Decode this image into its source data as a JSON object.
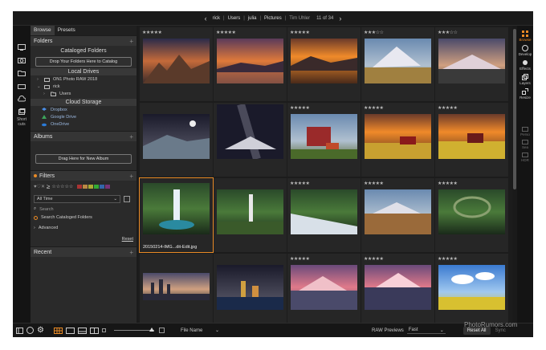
{
  "breadcrumb": [
    "rick",
    "Users",
    "julia",
    "Pictures",
    "Tim Uhler"
  ],
  "breadcrumb_seps": [
    "|",
    "|",
    "|",
    "|"
  ],
  "nav": {
    "prev": "‹",
    "next": "›",
    "count": "11 of 34"
  },
  "left_rail": {
    "shortcuts_label": "Short\ncuts"
  },
  "tabs": [
    "Browse",
    "Presets"
  ],
  "folders": {
    "title": "Folders",
    "cataloged_title": "Cataloged Folders",
    "drop_button": "Drop Your Folders Here to Catalog",
    "local_title": "Local Drives",
    "local_items": [
      "ON1 Photo RAW 2018",
      "rick",
      "Users"
    ],
    "cloud_title": "Cloud Storage",
    "cloud_items": [
      "Dropbox",
      "Google Drive",
      "OneDrive"
    ]
  },
  "albums": {
    "title": "Albums",
    "drag_button": "Drag Here for New Album"
  },
  "filters": {
    "title": "Filters",
    "rating_op": "≥",
    "time_value": "All Time",
    "search_label": "Search",
    "search_cataloged": "Search Cataloged Folders",
    "advanced": "Advanced",
    "reset": "Reset",
    "swatch_colors": [
      "#a33",
      "#b84",
      "#aa3",
      "#3a3",
      "#36a",
      "#737"
    ]
  },
  "recent": {
    "title": "Recent"
  },
  "grid": {
    "rows": [
      {
        "ratings": [
          "★★★★★",
          "★★★★★",
          "★★★★★",
          "★★★☆☆",
          "★★★☆☆"
        ]
      },
      {
        "ratings": [
          "",
          "",
          "★★★★★",
          "★★★★★",
          "★★★★★"
        ]
      },
      {
        "ratings": [
          "",
          "",
          "★★★★★",
          "★★★★★",
          "★★★★★"
        ]
      },
      {
        "ratings": [
          "",
          "",
          "★★★★★",
          "★★★★★",
          "★★★★★"
        ]
      }
    ],
    "selected_filename": "20150214-IMG...dit-Edit.jpg"
  },
  "right_rail": [
    "Browse",
    "Develop",
    "Effects",
    "Layers",
    "Resize",
    "Perso",
    "Sea",
    "HDR"
  ],
  "bottom": {
    "sort_label": "File Name",
    "raw_label": "RAW Previews",
    "raw_value": "Fast",
    "reset_all": "Reset All",
    "sync": "Sync"
  },
  "watermark": "PhotoRumors.com",
  "colors": {
    "accent": "#e98a25",
    "bg": "#1b1b1b",
    "panel": "#2a2a2a"
  }
}
